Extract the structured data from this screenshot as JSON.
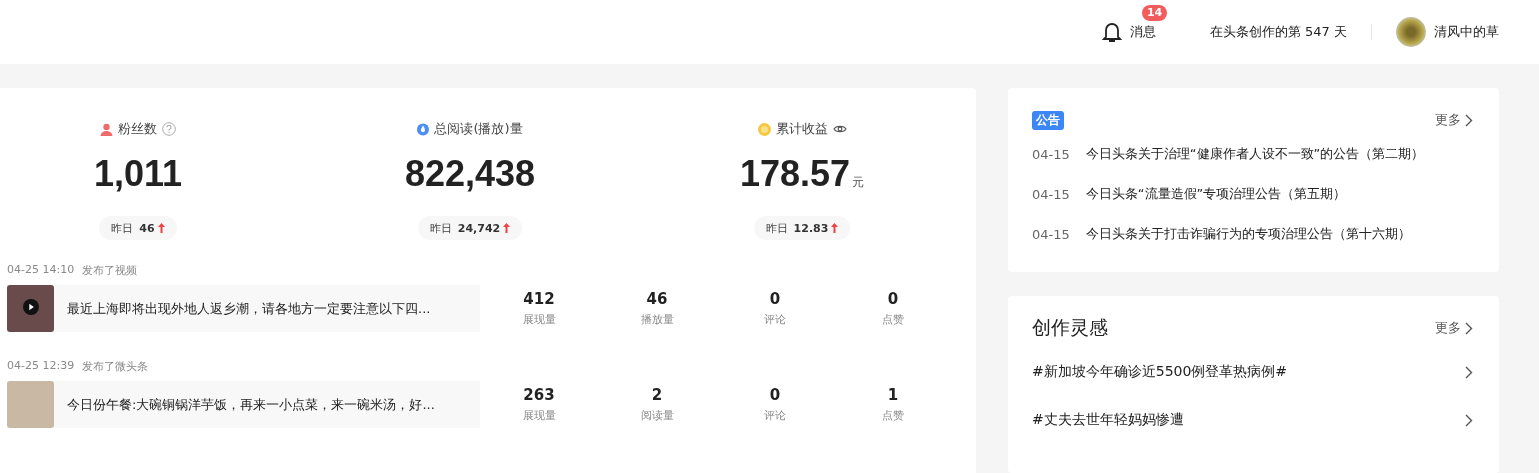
{
  "header": {
    "messages_label": "消息",
    "messages_badge": "14",
    "creation_days": "在头条创作的第 547 天",
    "user_name": "清风中的草"
  },
  "stats": [
    {
      "kind": "fans",
      "label": "粉丝数",
      "value": "1,011",
      "yesterday_label": "昨日",
      "yesterday_value": "46"
    },
    {
      "kind": "reads",
      "label": "总阅读(播放)量",
      "value": "822,438",
      "yesterday_label": "昨日",
      "yesterday_value": "24,742"
    },
    {
      "kind": "income",
      "label": "累计收益",
      "value": "178.57",
      "unit": "元",
      "yesterday_label": "昨日",
      "yesterday_value": "12.83"
    }
  ],
  "feed": [
    {
      "kind": "video",
      "time": "04-25 14:10",
      "action": "发布了视频",
      "title": "最近上海即将出现外地人返乡潮，请各地方一定要注意以下四...",
      "metrics": [
        {
          "value": "412",
          "label": "展现量"
        },
        {
          "value": "46",
          "label": "播放量"
        },
        {
          "value": "0",
          "label": "评论"
        },
        {
          "value": "0",
          "label": "点赞"
        }
      ]
    },
    {
      "kind": "post",
      "time": "04-25 12:39",
      "action": "发布了微头条",
      "title": "今日份午餐:大碗铜锅洋芋饭，再来一小点菜，来一碗米汤，好...",
      "metrics": [
        {
          "value": "263",
          "label": "展现量"
        },
        {
          "value": "2",
          "label": "阅读量"
        },
        {
          "value": "0",
          "label": "评论"
        },
        {
          "value": "1",
          "label": "点赞"
        }
      ]
    }
  ],
  "notices": {
    "tag": "公告",
    "more": "更多",
    "items": [
      {
        "date": "04-15",
        "title": "今日头条关于治理“健康作者人设不一致”的公告（第二期）"
      },
      {
        "date": "04-15",
        "title": "今日头条“流量造假”专项治理公告（第五期）"
      },
      {
        "date": "04-15",
        "title": "今日头条关于打击诈骗行为的专项治理公告（第十六期）"
      }
    ]
  },
  "inspiration": {
    "title": "创作灵感",
    "more": "更多",
    "items": [
      {
        "title": "#新加坡今年确诊近5500例登革热病例#"
      },
      {
        "title": "#丈夫去世年轻妈妈惨遭"
      }
    ]
  }
}
